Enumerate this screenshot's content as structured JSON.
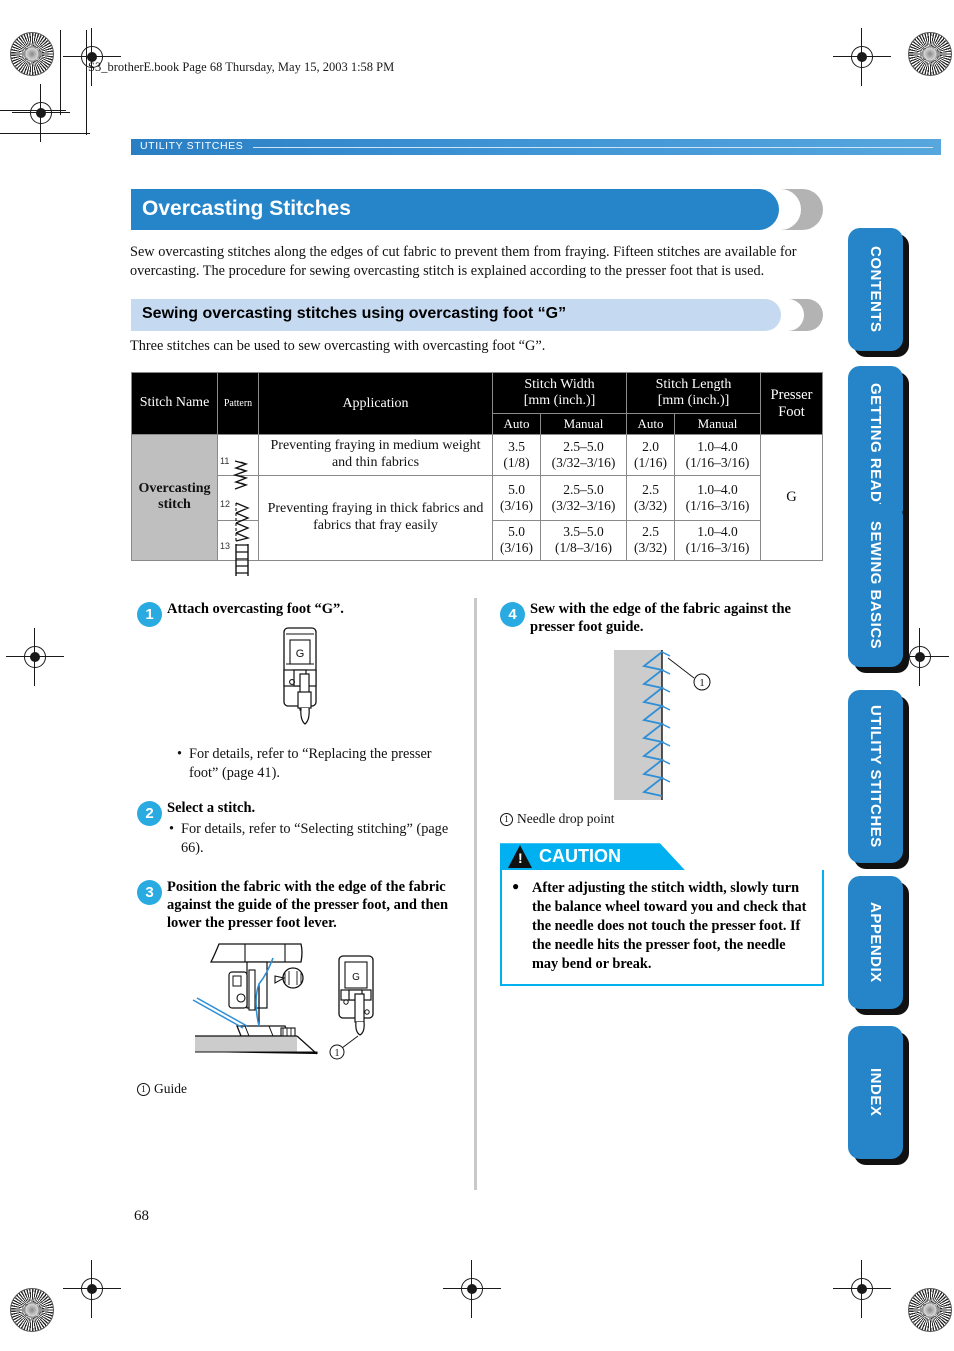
{
  "file_header": "S3_brotherE.book  Page 68  Thursday, May 15, 2003  1:58 PM",
  "running_head": {
    "label": "UTILITY STITCHES"
  },
  "title": "Overcasting Stitches",
  "intro": "Sew overcasting stitches along the edges of cut fabric to prevent them from fraying. Fifteen stitches are available for overcasting. The procedure for sewing overcasting stitch is explained according to the presser foot that is used.",
  "subsection": {
    "heading": "Sewing overcasting stitches using overcasting foot “G”",
    "note": "Three stitches can be used to sew overcasting with overcasting foot “G”."
  },
  "table": {
    "headers": {
      "stitch_name": "Stitch Name",
      "pattern": "Pattern",
      "application": "Application",
      "stitch_width": "Stitch Width",
      "stitch_width_unit": "[mm (inch.)]",
      "stitch_length": "Stitch Length",
      "stitch_length_unit": "[mm (inch.)]",
      "presser_foot": "Presser",
      "presser_foot2": "Foot",
      "auto": "Auto",
      "manual": "Manual",
      "auto2": "Auto",
      "manual2": "Manual"
    },
    "stitch_name": "Overcasting",
    "stitch_name2": "stitch",
    "presser_foot_value": "G",
    "rows": [
      {
        "pattern_no": "11",
        "application": "Preventing fraying in medium weight and thin fabrics",
        "width_auto_mm": "3.5",
        "width_auto_in": "(1/8)",
        "width_manual_mm": "2.5–5.0",
        "width_manual_in": "(3/32–3/16)",
        "length_auto_mm": "2.0",
        "length_auto_in": "(1/16)",
        "length_manual_mm": "1.0–4.0",
        "length_manual_in": "(1/16–3/16)"
      },
      {
        "pattern_no": "12",
        "application": "Preventing fraying in thick fabrics and fabrics that fray easily",
        "width_auto_mm": "5.0",
        "width_auto_in": "(3/16)",
        "width_manual_mm": "2.5–5.0",
        "width_manual_in": "(3/32–3/16)",
        "length_auto_mm": "2.5",
        "length_auto_in": "(3/32)",
        "length_manual_mm": "1.0–4.0",
        "length_manual_in": "(1/16–3/16)"
      },
      {
        "pattern_no": "13",
        "application": "",
        "width_auto_mm": "5.0",
        "width_auto_in": "(3/16)",
        "width_manual_mm": "3.5–5.0",
        "width_manual_in": "(1/8–3/16)",
        "length_auto_mm": "2.5",
        "length_auto_in": "(3/32)",
        "length_manual_mm": "1.0–4.0",
        "length_manual_in": "(1/16–3/16)"
      }
    ]
  },
  "steps": {
    "step1": {
      "number": "1",
      "heading": "Attach overcasting foot “G”.",
      "bullet": "For details, refer to “Replacing the presser foot” (page 41).",
      "foot_label": "G"
    },
    "step2": {
      "number": "2",
      "heading": "Select a stitch.",
      "bullet": "For details, refer to “Selecting stitching” (page 66)."
    },
    "step3": {
      "number": "3",
      "heading": "Position the fabric with the edge of the fabric against the guide of the presser foot, and then lower the presser foot lever.",
      "caption_num": "1",
      "caption": "Guide",
      "foot_label": "G"
    },
    "step4": {
      "number": "4",
      "heading": "Sew with the edge of the fabric against the presser foot guide.",
      "caption_num": "1",
      "caption": "Needle drop point",
      "callout_num": "1"
    }
  },
  "caution": {
    "title": "CAUTION",
    "text": "After adjusting the stitch width, slowly turn the balance wheel toward you and check that the needle does not touch the presser foot. If the needle hits the presser foot, the needle may bend or break."
  },
  "side_tabs": [
    {
      "label": "CONTENTS"
    },
    {
      "label": "GETTING READY"
    },
    {
      "label": "SEWING BASICS"
    },
    {
      "label": "UTILITY STITCHES"
    },
    {
      "label": "APPENDIX"
    },
    {
      "label": "INDEX"
    }
  ],
  "page_number": "68",
  "colors": {
    "heading_blue": "#2585c8",
    "subheading_blue": "#c5d9f1",
    "accent_cyan": "#29abe2",
    "caution_cyan": "#00b0f0",
    "thread_blue": "#2e8fd6",
    "fabric_gray": "#cccccc"
  }
}
